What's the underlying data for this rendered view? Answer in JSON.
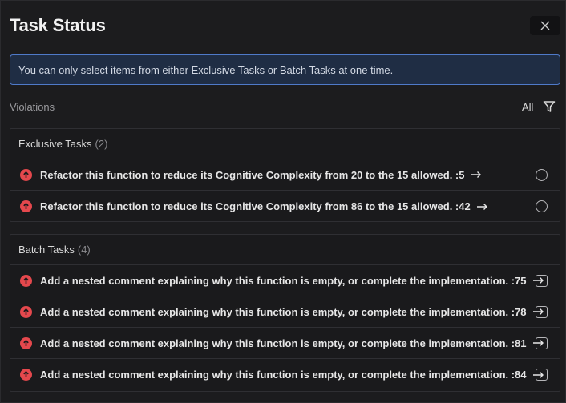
{
  "window": {
    "title": "Task Status"
  },
  "banner": {
    "text": "You can only select items from either Exclusive Tasks or Batch Tasks at one time."
  },
  "toolbar": {
    "violations_label": "Violations",
    "filter_label": "All"
  },
  "exclusive": {
    "label": "Exclusive Tasks",
    "count": "(2)",
    "items": [
      {
        "text": "Refactor this function to reduce its Cognitive Complexity from 20 to the 15 allowed. :5"
      },
      {
        "text": "Refactor this function to reduce its Cognitive Complexity from 86 to the 15 allowed. :42"
      }
    ]
  },
  "batch": {
    "label": "Batch Tasks",
    "count": "(4)",
    "items": [
      {
        "text": "Add a nested comment explaining why this function is empty, or complete the implementation. :75"
      },
      {
        "text": "Add a nested comment explaining why this function is empty, or complete the implementation. :78"
      },
      {
        "text": "Add a nested comment explaining why this function is empty, or complete the implementation. :81"
      },
      {
        "text": "Add a nested comment explaining why this function is empty, or complete the implementation. :84"
      }
    ]
  },
  "icons": {
    "close": "close-icon",
    "filter": "filter-icon",
    "severity": "severity-up-icon",
    "arrow": "arrow-right-icon"
  },
  "colors": {
    "background": "#1c1c1e",
    "banner_bg": "#1f2d44",
    "banner_border": "#4f7ac9",
    "severity": "#e5484d"
  }
}
